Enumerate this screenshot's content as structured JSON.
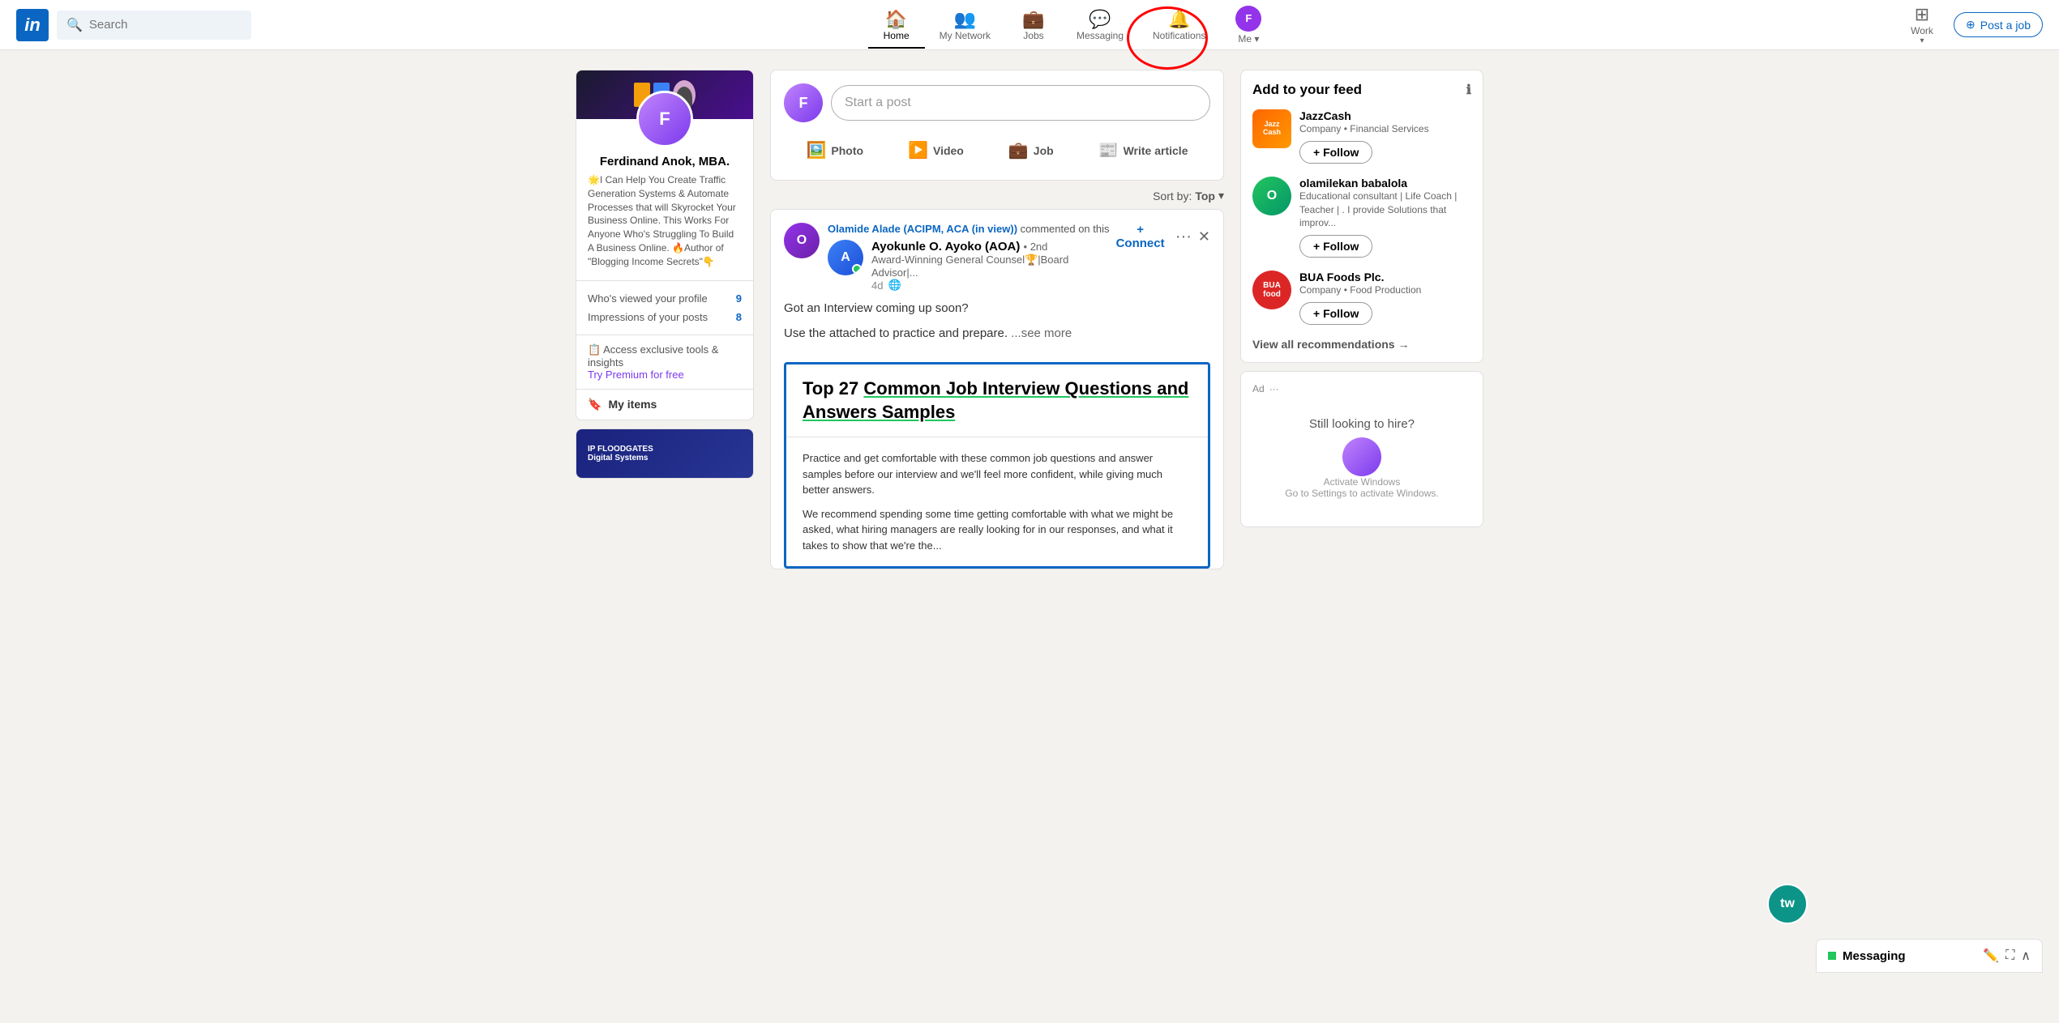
{
  "header": {
    "logo": "in",
    "search_placeholder": "Search",
    "nav_items": [
      {
        "id": "home",
        "label": "Home",
        "icon": "🏠",
        "active": true
      },
      {
        "id": "network",
        "label": "My Network",
        "icon": "👥",
        "active": false
      },
      {
        "id": "jobs",
        "label": "Jobs",
        "icon": "💼",
        "active": false
      },
      {
        "id": "messaging",
        "label": "Messaging",
        "icon": "💬",
        "active": false
      },
      {
        "id": "notifications",
        "label": "Notifications",
        "icon": "🔔",
        "active": false
      },
      {
        "id": "me",
        "label": "Me",
        "icon": "👤",
        "active": false
      }
    ],
    "work_label": "Work",
    "post_job_label": "Post a job"
  },
  "left_sidebar": {
    "profile": {
      "name": "Ferdinand Anok, MBA.",
      "description": "🌟I Can Help You Create Traffic Generation Systems & Automate Processes that will Skyrocket Your Business Online. This Works For Anyone Who's Struggling To Build A Business Online. 🔥Author of \"Blogging Income Secrets\"👇",
      "stats": [
        {
          "label": "Who's viewed your profile",
          "value": "9"
        },
        {
          "label": "Impressions of your posts",
          "value": "8"
        }
      ],
      "premium_text": "Access exclusive tools & insights",
      "premium_emoji": "📋",
      "premium_link": "Try Premium for free",
      "my_items_label": "My items",
      "bookmark_icon": "🔖"
    }
  },
  "feed": {
    "post_placeholder": "Start a post",
    "sort_label": "Sort by:",
    "sort_value": "Top",
    "post_actions": [
      {
        "id": "photo",
        "label": "Photo"
      },
      {
        "id": "video",
        "label": "Video"
      },
      {
        "id": "job",
        "label": "Job"
      },
      {
        "id": "article",
        "label": "Write article"
      }
    ],
    "posts": [
      {
        "commenter": "Olamide Alade (ACIPM, ACA (in view))",
        "commenter_action": "commented on this",
        "poster_name": "Ayokunle O. Ayoko (AOA)",
        "poster_degree": "2nd",
        "poster_title": "Award-Winning General Counsel🏆|Board Advisor|...",
        "poster_time": "4d",
        "connect_label": "+ Connect",
        "body_line1": "Got an Interview coming up soon?",
        "body_line2": "Use the attached to practice and prepare.",
        "see_more": "...see more",
        "image": {
          "title_bold": "Top 27 ",
          "title_underline": "Common Job Interview Questions and Answers Samples",
          "body_text1": "Practice and get comfortable with these common job questions and answer samples before our interview and we'll feel more confident, while giving much better answers.",
          "body_text2": "We recommend spending some time getting comfortable with what we might be asked, what hiring managers are really looking for in our responses, and what it takes to show that we're the..."
        }
      }
    ]
  },
  "right_sidebar": {
    "feed_title": "Add to your feed",
    "recommendations": [
      {
        "name": "JazzCash",
        "type": "Company",
        "industry": "Financial Services",
        "follow_label": "+ Follow"
      },
      {
        "name": "olamilekan babalola",
        "type": "Educational consultant | Life Coach | Teacher | . I provide Solutions that improv...",
        "follow_label": "+ Follow"
      },
      {
        "name": "BUA Foods Plc.",
        "type": "Company",
        "industry": "Food Production",
        "follow_label": "+ Follow"
      }
    ],
    "view_all": "View all recommendations →",
    "ad_label": "Ad",
    "ad_text": "Still looking to hire?",
    "activate_windows": "Activate Windows",
    "activate_settings": "Go to Settings to activate Windows."
  },
  "messaging": {
    "title": "Messaging",
    "new_icon": "✏️",
    "expand_icon": "⛶",
    "chevron_icon": "∧"
  }
}
